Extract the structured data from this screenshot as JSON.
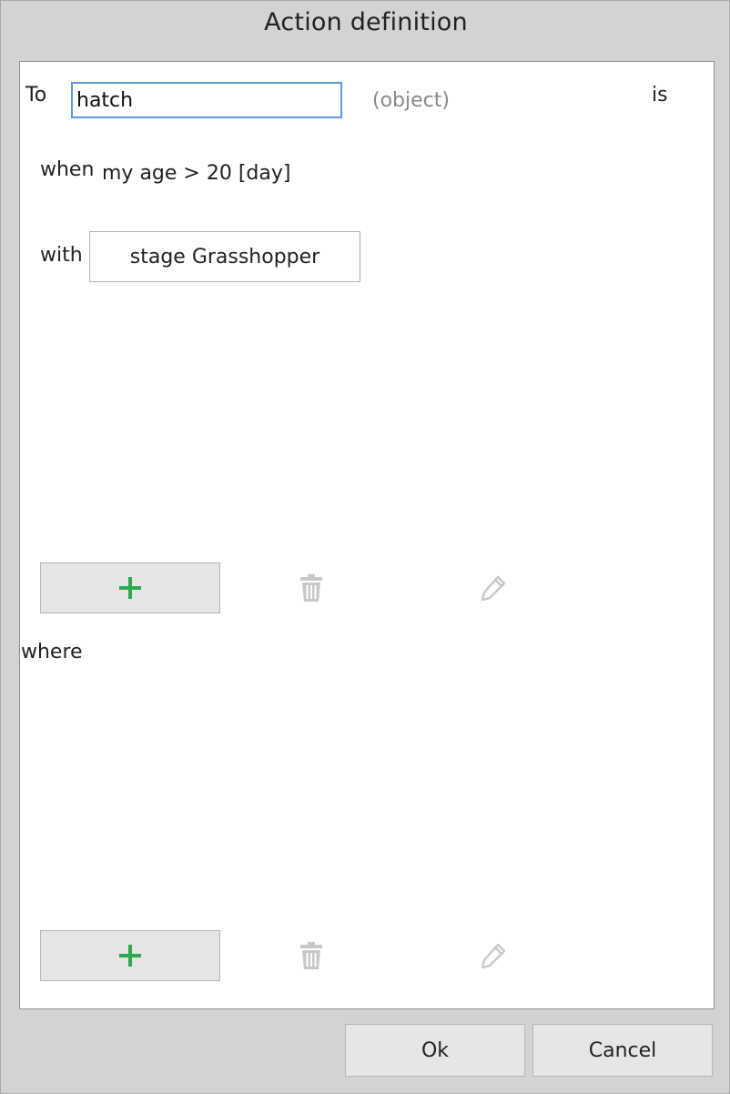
{
  "dialog": {
    "title": "Action definition"
  },
  "definition": {
    "to_label": "To",
    "name_value": "hatch",
    "object_hint": "(object)",
    "is_label": "is",
    "when_label": "when",
    "condition_text": "my age > 20 [day]",
    "with_label": "with",
    "with_value": "stage Grasshopper",
    "where_label": "where"
  },
  "icons": {
    "add": "plus-icon",
    "delete": "trash-icon",
    "edit": "pencil-icon"
  },
  "colors": {
    "add_icon": "#2fa84f",
    "disabled_icon": "#c8c8c8",
    "focus_border": "#5a9ad8"
  },
  "footer": {
    "ok_label": "Ok",
    "cancel_label": "Cancel"
  }
}
